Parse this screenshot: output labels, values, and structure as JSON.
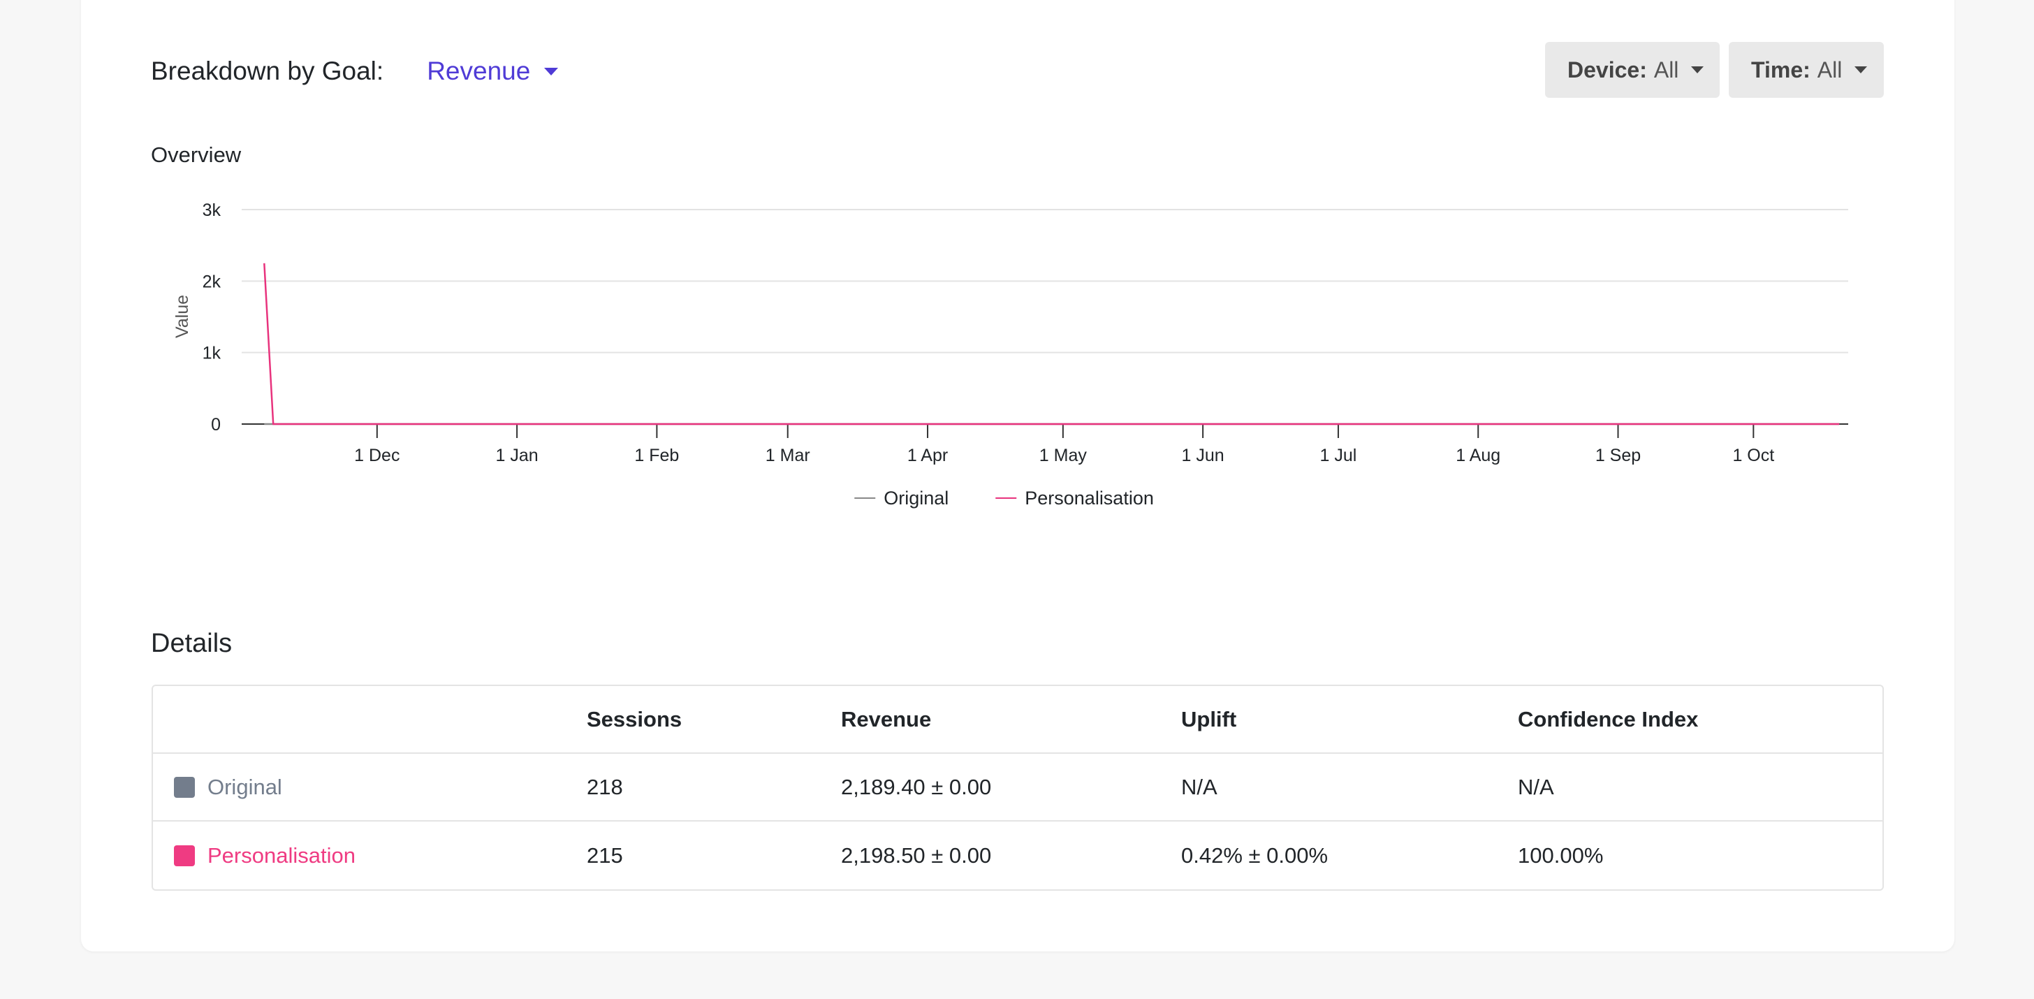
{
  "header": {
    "goal_label": "Breakdown by Goal:",
    "goal_value": "Revenue",
    "device_key": "Device:",
    "device_value": "All",
    "time_key": "Time:",
    "time_value": "All"
  },
  "overview": {
    "title": "Overview"
  },
  "chart_data": {
    "type": "line",
    "ylabel": "Value",
    "xlabel": "",
    "ylim": [
      0,
      3000
    ],
    "y_ticks": [
      "0",
      "1k",
      "2k",
      "3k"
    ],
    "y_tick_values": [
      0,
      1000,
      2000,
      3000
    ],
    "x_ticks": [
      "1 Dec",
      "1 Jan",
      "1 Feb",
      "1 Mar",
      "1 Apr",
      "1 May",
      "1 Jun",
      "1 Jul",
      "1 Aug",
      "1 Sep",
      "1 Oct"
    ],
    "x_tick_dates": [
      "2023-12-01",
      "2024-01-01",
      "2024-02-01",
      "2024-03-01",
      "2024-04-01",
      "2024-05-01",
      "2024-06-01",
      "2024-07-01",
      "2024-08-01",
      "2024-09-01",
      "2024-10-01"
    ],
    "xlim": [
      "2023-11-01",
      "2024-10-22"
    ],
    "grid": true,
    "legend_position": "bottom",
    "series": [
      {
        "name": "Original",
        "color": "#888888",
        "points": [
          [
            "2023-11-06",
            0
          ],
          [
            "2023-11-08",
            0
          ],
          [
            "2024-10-20",
            0
          ]
        ]
      },
      {
        "name": "Personalisation",
        "color": "#e8337d",
        "points": [
          [
            "2023-11-06",
            2250
          ],
          [
            "2023-11-08",
            0
          ],
          [
            "2024-10-20",
            0
          ]
        ]
      }
    ]
  },
  "details": {
    "title": "Details",
    "columns": [
      "",
      "Sessions",
      "Revenue",
      "Uplift",
      "Confidence Index"
    ],
    "rows": [
      {
        "name": "Original",
        "color": "#737d8c",
        "sessions": "218",
        "revenue": "2,189.40 ± 0.00",
        "uplift": "N/A",
        "confidence": "N/A"
      },
      {
        "name": "Personalisation",
        "color": "#ef3b82",
        "sessions": "215",
        "revenue": "2,198.50 ± 0.00",
        "uplift": "0.42% ± 0.00%",
        "confidence": "100.00%"
      }
    ]
  }
}
